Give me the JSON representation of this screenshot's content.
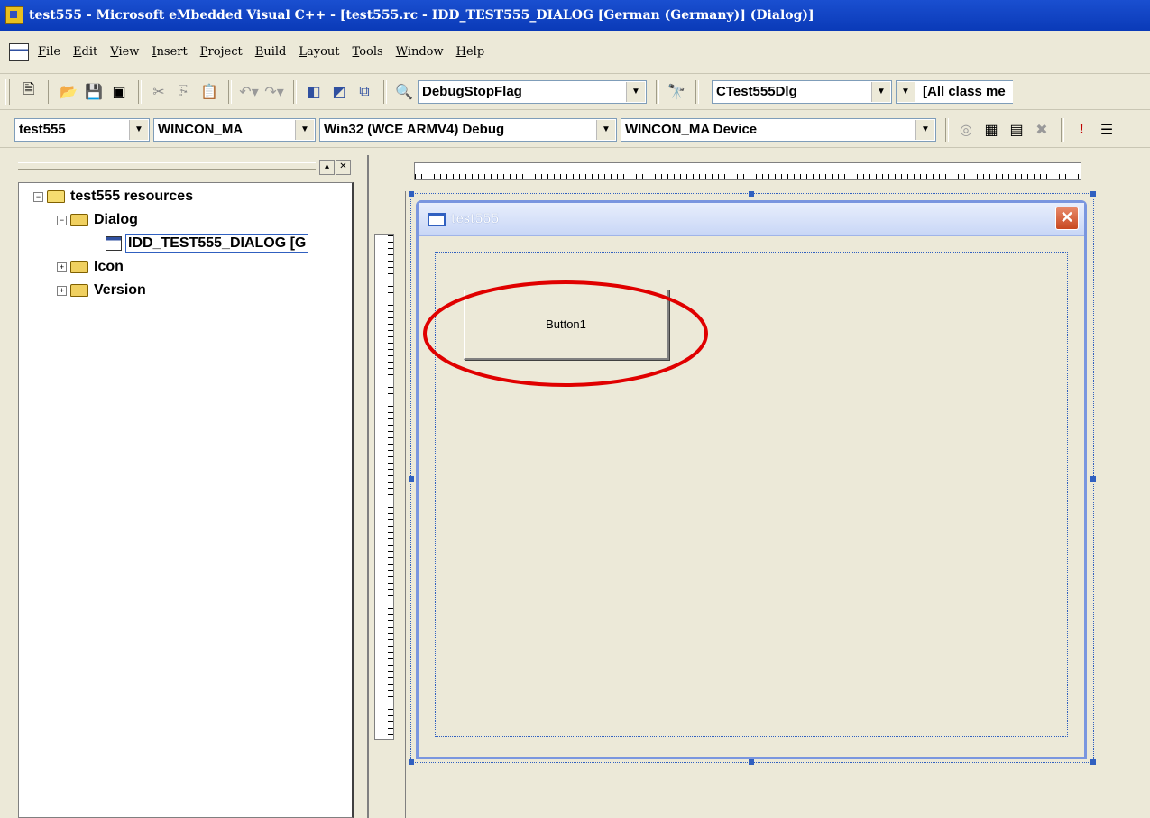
{
  "titlebar": {
    "title": "test555 - Microsoft eMbedded Visual C++ - [test555.rc - IDD_TEST555_DIALOG [German (Germany)] (Dialog)]",
    "icon": "evc-app-icon"
  },
  "menu": [
    {
      "key": "F",
      "rest": "ile"
    },
    {
      "key": "E",
      "rest": "dit"
    },
    {
      "key": "V",
      "rest": "iew"
    },
    {
      "key": "I",
      "rest": "nsert"
    },
    {
      "key": "P",
      "rest": "roject"
    },
    {
      "key": "B",
      "rest": "uild"
    },
    {
      "key": "L",
      "rest": "ayout"
    },
    {
      "key": "T",
      "rest": "ools"
    },
    {
      "key": "W",
      "rest": "indow"
    },
    {
      "key": "H",
      "rest": "elp"
    }
  ],
  "toolbar1": {
    "find_combo": "DebugStopFlag",
    "class_combo": "CTest555Dlg",
    "members_combo": "[All class me"
  },
  "toolbar2": {
    "project_combo": "test555",
    "platform_combo": "WINCON_MA",
    "config_combo": "Win32 (WCE ARMV4) Debug",
    "device_combo": "WINCON_MA Device"
  },
  "tree": {
    "root": "test555 resources",
    "dialog_folder": "Dialog",
    "dialog_item": "IDD_TEST555_DIALOG [G",
    "icon_folder": "Icon",
    "version_folder": "Version"
  },
  "dialog": {
    "title": "test555",
    "close": "✕",
    "button1": "Button1"
  },
  "colors": {
    "annotation": "#e00000",
    "selection": "#3060c0"
  }
}
